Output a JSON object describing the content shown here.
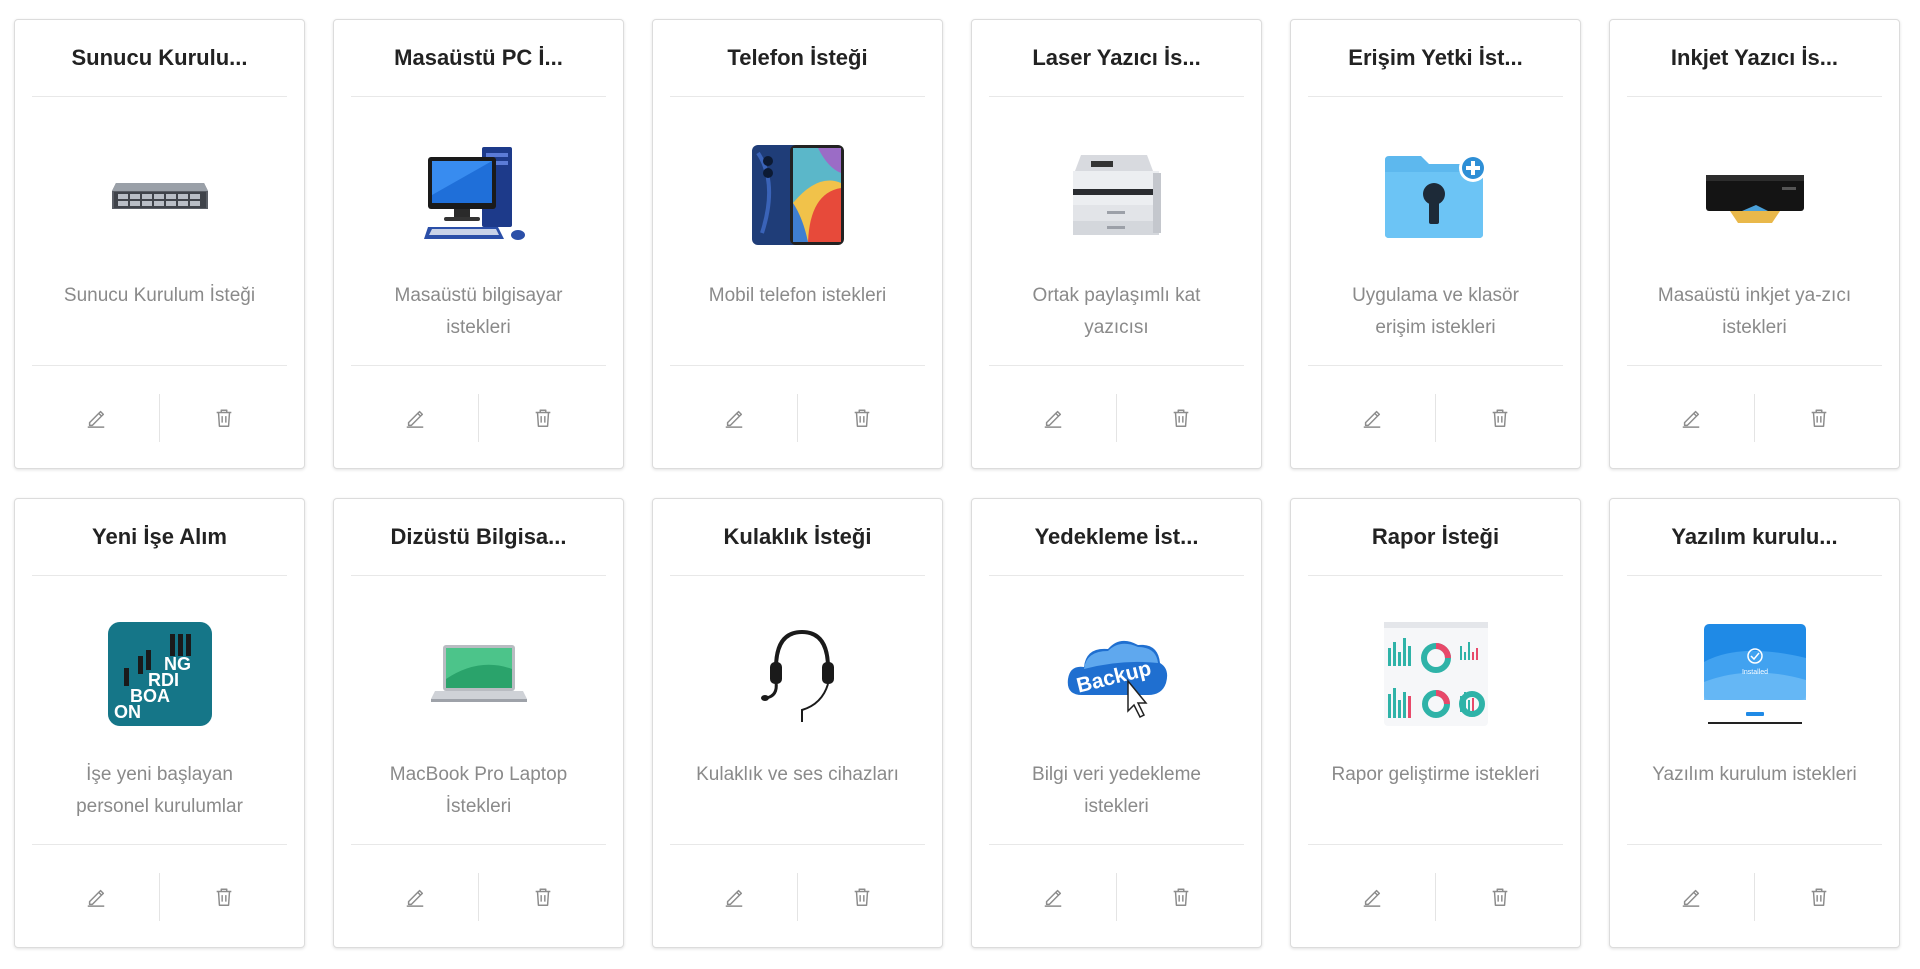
{
  "cards": [
    {
      "title": "Sunucu Kurulu...",
      "description": "Sunucu Kurulum İsteği",
      "icon": "server-icon"
    },
    {
      "title": "Masaüstü PC İ...",
      "description": "Masaüstü bilgisayar istekleri",
      "icon": "desktop-pc-icon"
    },
    {
      "title": "Telefon İsteği",
      "description": "Mobil telefon istekleri",
      "icon": "smartphone-icon"
    },
    {
      "title": "Laser Yazıcı İs...",
      "description": "Ortak paylaşımlı kat yazıcısı",
      "icon": "laser-printer-icon"
    },
    {
      "title": "Erişim Yetki İst...",
      "description": "Uygulama ve klasör erişim istekleri",
      "icon": "locked-folder-icon"
    },
    {
      "title": "Inkjet Yazıcı İs...",
      "description": "Masaüstü inkjet ya-zıcı istekleri",
      "icon": "inkjet-printer-icon"
    },
    {
      "title": "Yeni İşe Alım",
      "description": "İşe yeni başlayan personel kurulumlar",
      "icon": "onboarding-icon",
      "image_text": [
        "NG",
        "RDI",
        "BOA",
        "ON"
      ]
    },
    {
      "title": "Dizüstü Bilgisa...",
      "description": "MacBook Pro Laptop İstekleri",
      "icon": "laptop-icon"
    },
    {
      "title": "Kulaklık İsteği",
      "description": "Kulaklık ve ses cihazları",
      "icon": "headset-icon"
    },
    {
      "title": "Yedekleme İst...",
      "description": "Bilgi veri yedekleme istekleri",
      "icon": "backup-cloud-icon",
      "image_text": [
        "Backup"
      ]
    },
    {
      "title": "Rapor İsteği",
      "description": "Rapor geliştirme istekleri",
      "icon": "report-dashboard-icon"
    },
    {
      "title": "Yazılım kurulu...",
      "description": "Yazılım kurulum istekleri",
      "icon": "software-install-icon",
      "image_text": [
        "Installed"
      ]
    }
  ],
  "actions": {
    "edit_icon": "pencil-icon",
    "delete_icon": "trash-icon"
  },
  "colors": {
    "title": "#222222",
    "description": "#8a8a8a",
    "icon": "#8c8c8c",
    "border": "#dcdcdc"
  }
}
